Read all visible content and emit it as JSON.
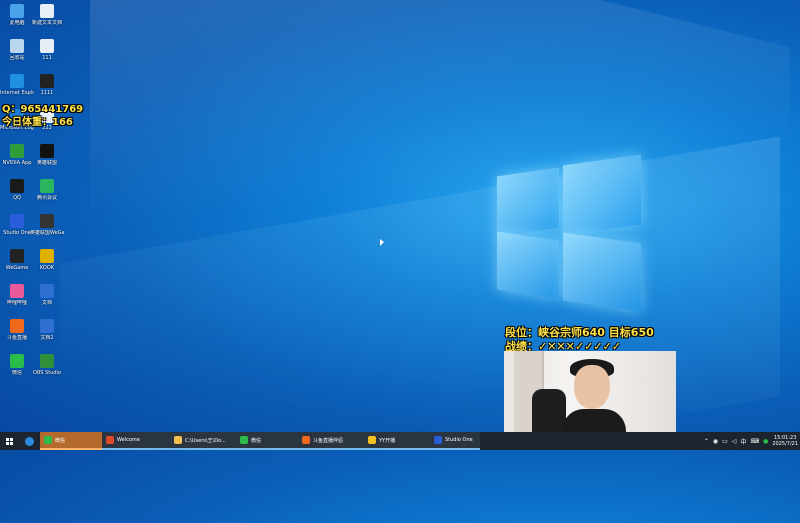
{
  "desktop_icons": [
    {
      "label": "此电脑",
      "icon": "computer-icon",
      "color": "#4aa3e8"
    },
    {
      "label": "新建文本文档",
      "icon": "text-file-icon",
      "color": "#e8eef5"
    },
    {
      "label": "回收站",
      "icon": "recycle-bin-icon",
      "color": "#b9d6ee"
    },
    {
      "label": "111",
      "icon": "document-icon",
      "color": "#e8eef5"
    },
    {
      "label": "Internet Explorer",
      "icon": "ie-icon",
      "color": "#1f8fe0"
    },
    {
      "label": "1111",
      "icon": "media-icon",
      "color": "#222222"
    },
    {
      "label": "Microsoft Edge",
      "icon": "edge-icon",
      "color": "#1b7fd6"
    },
    {
      "label": "222",
      "icon": "document-icon",
      "color": "#e8eef5"
    },
    {
      "label": "NVIDIA App",
      "icon": "nvidia-icon",
      "color": "#2e9e3a"
    },
    {
      "label": "英雄联盟",
      "icon": "game-icon",
      "color": "#111111"
    },
    {
      "label": "QQ",
      "icon": "qq-icon",
      "color": "#1a1a1a"
    },
    {
      "label": "腾讯会议",
      "icon": "meeting-icon",
      "color": "#2bb55f"
    },
    {
      "label": "Studio One",
      "icon": "studio-one-icon",
      "color": "#2a5dd9"
    },
    {
      "label": "英雄联盟WeGame版",
      "icon": "lol-icon",
      "color": "#333333"
    },
    {
      "label": "WeGame",
      "icon": "wegame-icon",
      "color": "#222222"
    },
    {
      "label": "KOOK",
      "icon": "kook-icon",
      "color": "#e0b000"
    },
    {
      "label": "哔哩哔哩",
      "icon": "bilibili-icon",
      "color": "#e85a9a"
    },
    {
      "label": "文档",
      "icon": "word-doc-icon",
      "color": "#2f6fd1"
    },
    {
      "label": "斗鱼直播",
      "icon": "douyu-icon",
      "color": "#ee6a1a"
    },
    {
      "label": "文档2",
      "icon": "word-doc-icon",
      "color": "#2f6fd1"
    },
    {
      "label": "微信",
      "icon": "wechat-icon",
      "color": "#2bbd4a"
    },
    {
      "label": "OBS Studio",
      "icon": "obs-icon",
      "color": "#2f8f3a"
    }
  ],
  "overlay": {
    "qq": "Q：965441769",
    "weight": "今日体重：166",
    "rank": "段位：峡谷宗师640  目标650",
    "record": "战绩：✓✕✕✕✓✓✓✓✓"
  },
  "taskbar": {
    "apps": [
      {
        "label": "微信",
        "icon": "wechat-icon",
        "color": "#2bbd4a",
        "state": "active",
        "width": 62
      },
      {
        "label": "Welcome",
        "icon": "wegame-icon",
        "color": "#e04a2a",
        "state": "open",
        "width": 68
      },
      {
        "label": "C:\\Users\\王\\Do...",
        "icon": "folder-icon",
        "color": "#f3c04a",
        "state": "open",
        "width": 66
      },
      {
        "label": "微信",
        "icon": "wechat-icon",
        "color": "#2bbd4a",
        "state": "open",
        "width": 62
      },
      {
        "label": "斗鱼直播伴侣",
        "icon": "douyu-icon",
        "color": "#ee6a1a",
        "state": "open",
        "width": 66
      },
      {
        "label": "YY开播",
        "icon": "yy-icon",
        "color": "#f0c020",
        "state": "open",
        "width": 66
      },
      {
        "label": "Studio One",
        "icon": "studio-one-icon",
        "color": "#2a5dd9",
        "state": "open",
        "width": 50
      }
    ],
    "tray": {
      "input_method": "中",
      "time": "15:01:23",
      "date": "2025/7/21"
    }
  }
}
